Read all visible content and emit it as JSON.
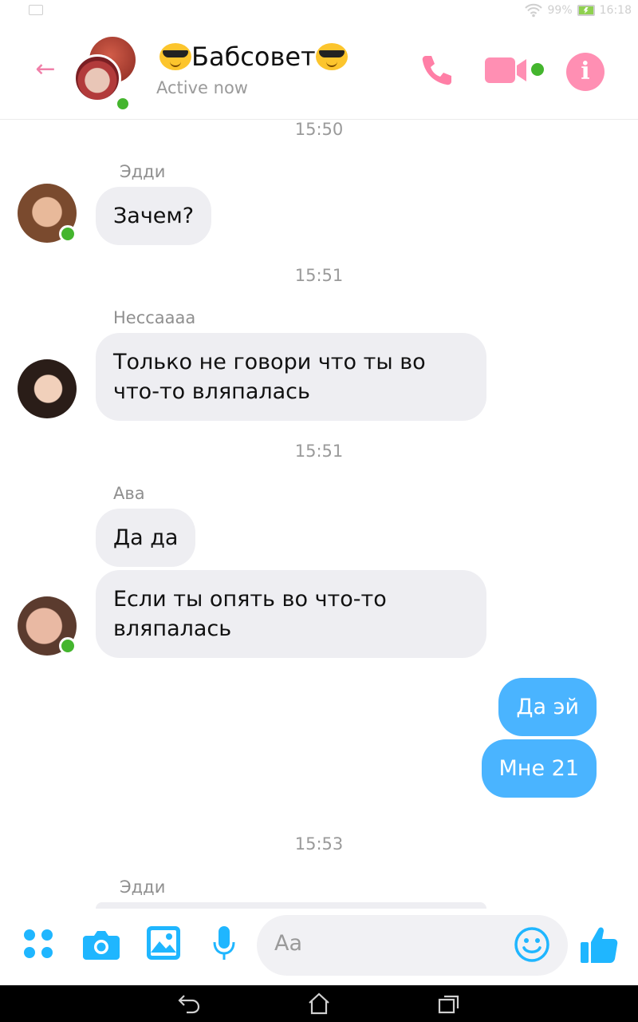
{
  "status_bar": {
    "battery": "99%",
    "time": "16:18"
  },
  "header": {
    "title": "Бабсовет",
    "subtitle": "Active now",
    "icons": {
      "back": "back-arrow-icon",
      "phone": "phone-icon",
      "video": "video-camera-icon",
      "info": "info-icon"
    },
    "accent_color": "#f06292"
  },
  "messages": [
    {
      "time": "15:50",
      "sender": "Эдди",
      "bubbles": [
        "Зачем?"
      ]
    },
    {
      "time": "15:51",
      "sender": "Нессаааа",
      "bubbles": [
        "Только не говори что ты во\nчто-то вляпалась"
      ]
    },
    {
      "time": "15:51",
      "sender": "Ава",
      "bubbles": [
        "Да да",
        "Если ты опять во что-то\nвляпалась"
      ]
    },
    {
      "outgoing": [
        "Да эй",
        "Мне 21"
      ]
    },
    {
      "time": "15:53",
      "sender": "Эдди"
    }
  ],
  "composer": {
    "placeholder": "Aa",
    "icons": [
      "apps-icon",
      "camera-icon",
      "image-icon",
      "microphone-icon",
      "emoji-icon",
      "thumbs-up-icon"
    ],
    "accent_color": "#1fb6ff"
  },
  "colors": {
    "incoming_bubble": "#eeeef2",
    "outgoing_bubble": "#4ab4ff",
    "online": "#44b52e"
  }
}
